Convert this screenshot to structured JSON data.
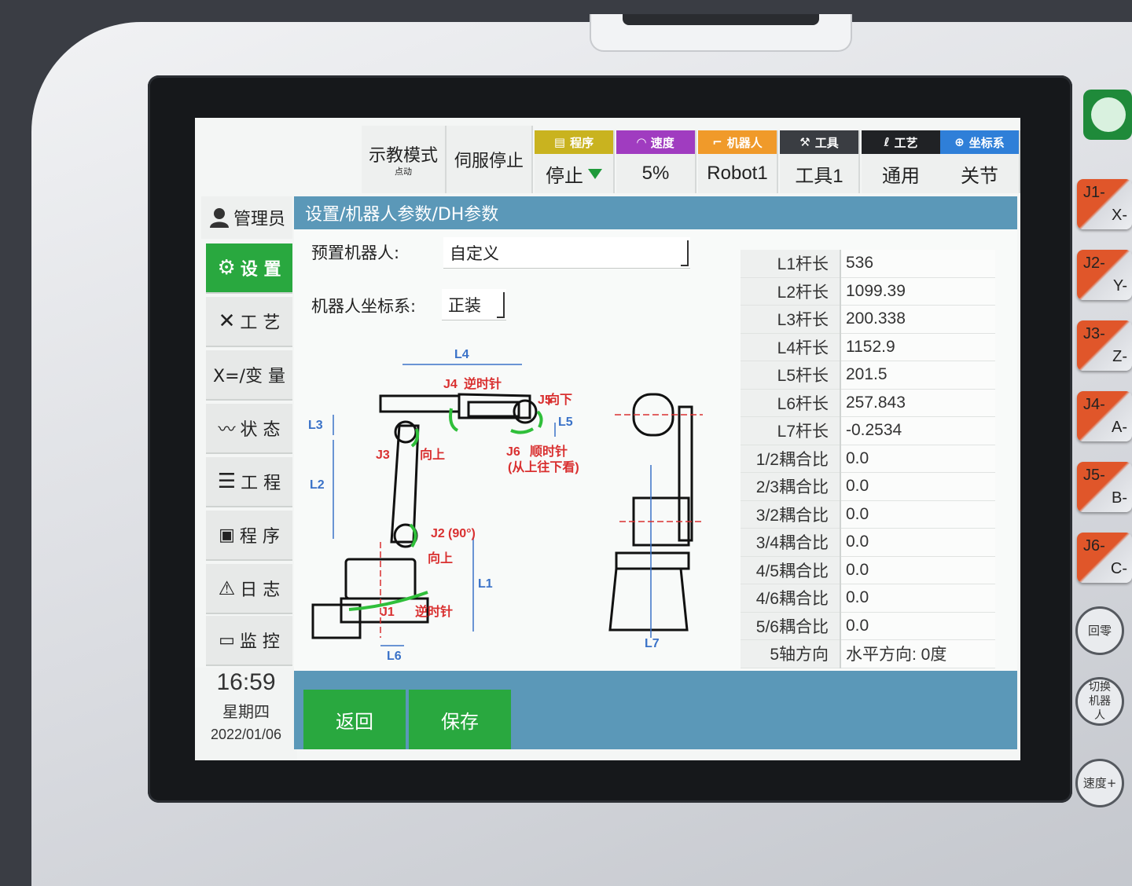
{
  "topbar": {
    "mode_label": "示教模式",
    "mode_sub": "点动",
    "servo_label": "伺服停止",
    "status": [
      {
        "head": "程序",
        "value": "停止",
        "color": "#c9b31f",
        "icon": "program-icon"
      },
      {
        "head": "速度",
        "value": "5%",
        "color": "#a03cc0",
        "icon": "speedometer-icon"
      },
      {
        "head": "机器人",
        "value": "Robot1",
        "color": "#f09a2a",
        "icon": "robot-arm-icon"
      },
      {
        "head": "工具",
        "value": "工具1",
        "color": "#3a3d42",
        "icon": "tool-icon"
      },
      {
        "head": "工艺",
        "value": "通用",
        "color": "#202225",
        "icon": "process-icon"
      },
      {
        "head": "坐标系",
        "value": "关节",
        "color": "#2f7fd8",
        "icon": "coordinate-icon"
      }
    ]
  },
  "sidebar": {
    "user_label": "管理员",
    "items": [
      {
        "label": "设 置",
        "icon": "gear-icon",
        "active": true
      },
      {
        "label": "工 艺",
        "icon": "tools-icon",
        "active": false
      },
      {
        "label": "X=/变 量",
        "icon": "variable-icon",
        "active": false
      },
      {
        "label": "状 态",
        "icon": "status-icon",
        "active": false
      },
      {
        "label": "工 程",
        "icon": "list-icon",
        "active": false
      },
      {
        "label": "程 序",
        "icon": "program-file-icon",
        "active": false
      },
      {
        "label": "日 志",
        "icon": "warning-icon",
        "active": false
      },
      {
        "label": "监 控",
        "icon": "monitor-icon",
        "active": false
      }
    ],
    "clock": {
      "time": "16:59",
      "weekday": "星期四",
      "date": "2022/01/06"
    }
  },
  "page": {
    "breadcrumb": "设置/机器人参数/DH参数",
    "preset_label": "预置机器人:",
    "preset_value": "自定义",
    "coord_label": "机器人坐标系:",
    "coord_value": "正装"
  },
  "diagram": {
    "labels": {
      "L1": "L1",
      "L2": "L2",
      "L3": "L3",
      "L4": "L4",
      "L5": "L5",
      "L6": "L6",
      "L7": "L7",
      "J1": "J1",
      "J2": "J2",
      "J3": "J3",
      "J4": "J4",
      "J5": "J5",
      "J6": "J6",
      "j1_dir": "逆时针",
      "j2_angle": "(90°)",
      "j2_dir": "向上",
      "j3_dir": "向上",
      "j4_dir": "逆时针",
      "j5_dir": "向下",
      "j6_dir": "顺时针",
      "j6_note": "(从上往下看)"
    }
  },
  "params": [
    {
      "name": "L1杆长",
      "value": "536"
    },
    {
      "name": "L2杆长",
      "value": "1099.39"
    },
    {
      "name": "L3杆长",
      "value": "200.338"
    },
    {
      "name": "L4杆长",
      "value": "1152.9"
    },
    {
      "name": "L5杆长",
      "value": "201.5"
    },
    {
      "name": "L6杆长",
      "value": "257.843"
    },
    {
      "name": "L7杆长",
      "value": "-0.2534"
    },
    {
      "name": "1/2耦合比",
      "value": "0.0"
    },
    {
      "name": "2/3耦合比",
      "value": "0.0"
    },
    {
      "name": "3/2耦合比",
      "value": "0.0"
    },
    {
      "name": "3/4耦合比",
      "value": "0.0"
    },
    {
      "name": "4/5耦合比",
      "value": "0.0"
    },
    {
      "name": "4/6耦合比",
      "value": "0.0"
    },
    {
      "name": "5/6耦合比",
      "value": "0.0"
    },
    {
      "name": "5轴方向",
      "value": "水平方向: 0度"
    }
  ],
  "actions": {
    "back_label": "返回",
    "save_label": "保存"
  },
  "hardware_keys": {
    "jog": [
      {
        "top": "J1-",
        "bottom": "X-"
      },
      {
        "top": "J2-",
        "bottom": "Y-"
      },
      {
        "top": "J3-",
        "bottom": "Z-"
      },
      {
        "top": "J4-",
        "bottom": "A-"
      },
      {
        "top": "J5-",
        "bottom": "B-"
      },
      {
        "top": "J6-",
        "bottom": "C-"
      }
    ],
    "home_label": "回零",
    "switch_robot_label": "切换机器人",
    "speed_plus_label": "速度+"
  }
}
